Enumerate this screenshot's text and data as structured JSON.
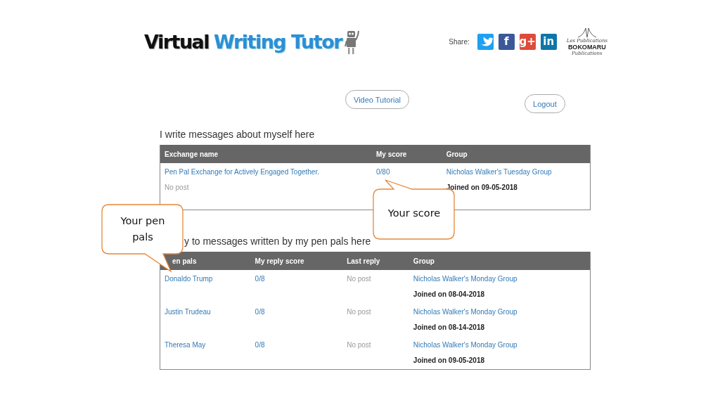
{
  "logo": {
    "dark_word": "Virtual",
    "blue_words": "Writing Tutor"
  },
  "share": {
    "label": "Share:",
    "icons": [
      {
        "kind": "bird",
        "color": "#1da1f2"
      },
      {
        "kind": "letter",
        "glyph": "f",
        "color": "#3b5998"
      },
      {
        "kind": "letter",
        "glyph": "g+",
        "color": "#dd4b39"
      },
      {
        "kind": "letter",
        "glyph": "in",
        "color": "#0e76a8"
      }
    ]
  },
  "publisher": {
    "top": "Les Publications",
    "name": "BOKOMARU",
    "bottom": "Publications"
  },
  "buttons": {
    "tutorial": "Video Tutorial",
    "logout": "Logout"
  },
  "sections": [
    {
      "heading": "I write messages about myself here",
      "columns": [
        "Exchange name",
        "My score",
        "Group"
      ],
      "rows": [
        {
          "cells": [
            [
              {
                "text": "Pen Pal Exchange for Actively Engaged Together.",
                "kind": "link"
              },
              {
                "text": "No post",
                "kind": "muted"
              }
            ],
            [
              {
                "text": "0/80",
                "kind": "link"
              }
            ],
            [
              {
                "text": "Nicholas Walker's Tuesday Group",
                "kind": "link"
              },
              {
                "text": "Joined on 09-05-2018",
                "kind": "bold"
              }
            ]
          ]
        }
      ]
    },
    {
      "heading": "y to messages written by my pen pals here",
      "columns": [
        "en pals",
        "My reply score",
        "Last reply",
        "Group"
      ],
      "rows": [
        {
          "cells": [
            [
              {
                "text": "Donaldo Trump",
                "kind": "link"
              }
            ],
            [
              {
                "text": "0/8",
                "kind": "link"
              }
            ],
            [
              {
                "text": "No post",
                "kind": "muted"
              }
            ],
            [
              {
                "text": "Nicholas Walker's Monday Group",
                "kind": "link"
              },
              {
                "text": "Joined on 08-04-2018",
                "kind": "bold"
              }
            ]
          ]
        },
        {
          "cells": [
            [
              {
                "text": "Justin Trudeau",
                "kind": "link"
              }
            ],
            [
              {
                "text": "0/8",
                "kind": "link"
              }
            ],
            [
              {
                "text": "No post",
                "kind": "muted"
              }
            ],
            [
              {
                "text": "Nicholas Walker's Monday Group",
                "kind": "link"
              },
              {
                "text": "Joined on 08-14-2018",
                "kind": "bold"
              }
            ]
          ]
        },
        {
          "cells": [
            [
              {
                "text": "Theresa May",
                "kind": "link"
              }
            ],
            [
              {
                "text": "0/8",
                "kind": "link"
              }
            ],
            [
              {
                "text": "No post",
                "kind": "muted"
              }
            ],
            [
              {
                "text": "Nicholas Walker's Monday Group",
                "kind": "link"
              },
              {
                "text": "Joined on 09-05-2018",
                "kind": "bold"
              }
            ]
          ]
        }
      ]
    }
  ],
  "callouts": [
    {
      "text": "Your score",
      "kind": "up"
    },
    {
      "text": "Your pen pals",
      "kind": "down"
    }
  ]
}
